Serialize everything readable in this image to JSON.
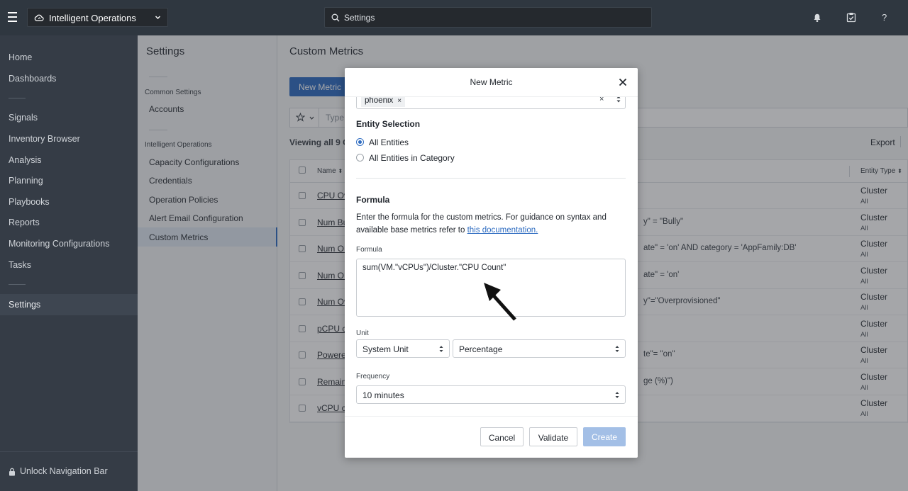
{
  "topbar": {
    "app_name": "Intelligent Operations",
    "search_text": "Settings",
    "icons": [
      "menu-icon",
      "cloud-icon",
      "chevron-down-icon",
      "search-icon",
      "bell-icon",
      "clipboard-check-icon",
      "help-icon"
    ]
  },
  "leftnav": {
    "items": [
      "Home",
      "Dashboards",
      "Signals",
      "Inventory Browser",
      "Analysis",
      "Planning",
      "Playbooks",
      "Reports",
      "Monitoring Configurations",
      "Tasks",
      "Settings"
    ],
    "unlock_label": "Unlock Navigation Bar"
  },
  "settings_panel": {
    "title": "Settings",
    "common_heading": "Common Settings",
    "accounts": "Accounts",
    "io_heading": "Intelligent Operations",
    "items": [
      "Capacity Configurations",
      "Credentials",
      "Operation Policies",
      "Alert Email Configuration",
      "Custom Metrics"
    ]
  },
  "main": {
    "title": "Custom Metrics",
    "new_metric_label": "New Metric",
    "filter_placeholder": "Type",
    "viewing": "Viewing all 9 C",
    "export_label": "Export",
    "table": {
      "col_name": "Name",
      "col_entity_type": "Entity Type",
      "rows": [
        {
          "name": "CPU Ov",
          "desc": "",
          "type": "Cluster",
          "category": "All"
        },
        {
          "name": "Num Bu",
          "desc": "y\" = \"Bully\"",
          "type": "Cluster",
          "category": "All"
        },
        {
          "name": "Num ON",
          "desc": "ate\" = 'on' AND category = 'AppFamily:DB'",
          "type": "Cluster",
          "category": "All"
        },
        {
          "name": "Num ON",
          "desc": "ate\" = 'on'",
          "type": "Cluster",
          "category": "All"
        },
        {
          "name": "Num Ov",
          "desc": "y\"=\"Overprovisioned\"",
          "type": "Cluster",
          "category": "All"
        },
        {
          "name": "pCPU c",
          "desc": "",
          "type": "Cluster",
          "category": "All"
        },
        {
          "name": "Powere",
          "desc": "te\"= \"on\"",
          "type": "Cluster",
          "category": "All"
        },
        {
          "name": "Remain",
          "desc": "ge (%)\")",
          "type": "Cluster",
          "category": "All"
        },
        {
          "name": "vCPU co",
          "desc": "",
          "type": "Cluster",
          "category": "All"
        }
      ]
    }
  },
  "modal": {
    "title": "New Metric",
    "tag": "phoenix",
    "tag_remove": "×",
    "tag_clear": "×",
    "entity_selection_title": "Entity Selection",
    "radio_all": "All Entities",
    "radio_category": "All Entities in Category",
    "formula_title": "Formula",
    "formula_help": "Enter the formula for the custom metrics. For guidance on syntax and available base metrics refer to ",
    "formula_help_link": "this documentation.",
    "formula_label": "Formula",
    "formula_value": "sum(VM.\"vCPUs\")/Cluster.\"CPU Count\"",
    "unit_label": "Unit",
    "unit_system": "System Unit",
    "unit_value": "Percentage",
    "frequency_label": "Frequency",
    "frequency_value": "10 minutes",
    "cancel_label": "Cancel",
    "validate_label": "Validate",
    "create_label": "Create"
  }
}
